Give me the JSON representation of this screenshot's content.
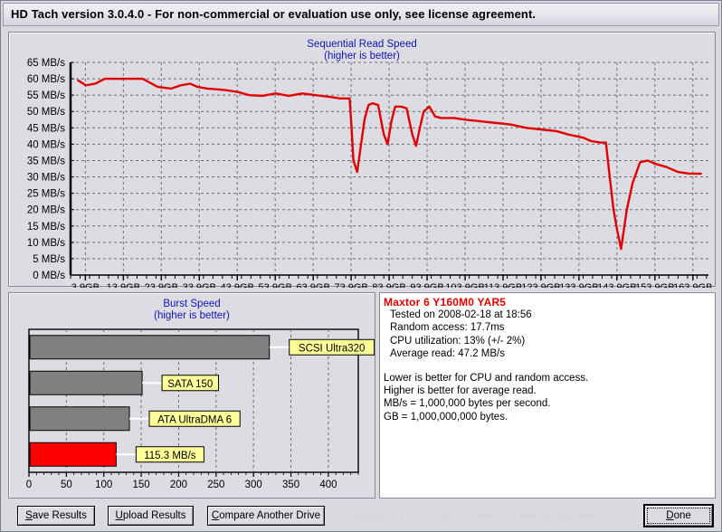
{
  "window": {
    "title": "HD Tach version 3.0.4.0  - For non-commercial or evaluation use only, see license agreement."
  },
  "sequential": {
    "title_line1": "Sequential Read Speed",
    "title_line2": "(higher is better)"
  },
  "burst": {
    "title_line1": "Burst Speed",
    "title_line2": "(higher is better)"
  },
  "info": {
    "drive": "Maxtor 6 Y160M0 YAR5",
    "tested": "Tested on 2008-02-18 at 18:56",
    "random_access": "Random access: 17.7ms",
    "cpu": "CPU utilization: 13% (+/- 2%)",
    "avg_read": "Average read: 47.2 MB/s",
    "note1": "Lower is better for CPU and random access.",
    "note2": "Higher is better for average read.",
    "note3": "MB/s = 1,000,000 bytes per second.",
    "note4": "GB = 1,000,000,000 bytes."
  },
  "buttons": {
    "save": "Save Results",
    "save_accel": "S",
    "upload": "Upload Results",
    "upload_accel": "U",
    "compare": "Compare Another Drive",
    "compare_accel": "C",
    "done": "Done",
    "done_accel": "D"
  },
  "copyright": "Copyright (C) 2004 Simpli Software, Inc. www.simplisoftware.com",
  "colors": {
    "curve": "#e00000",
    "bar_gray": "#808080",
    "bar_red": "#ff0000",
    "label_yellow": "#ffff99",
    "title_blue": "#1414b4",
    "panel_bg": "#dcdce2",
    "plot_bg": "#dcdce2"
  },
  "chart_data": [
    {
      "type": "line",
      "id": "sequential-read-speed",
      "title": "Sequential Read Speed",
      "subtitle": "(higher is better)",
      "xlabel": "",
      "ylabel": "",
      "grid": true,
      "legend": null,
      "xlim": [
        0,
        168
      ],
      "ylim": [
        0,
        65
      ],
      "ytick_labels": [
        "0 MB/s",
        "5 MB/s",
        "10 MB/s",
        "15 MB/s",
        "20 MB/s",
        "25 MB/s",
        "30 MB/s",
        "35 MB/s",
        "40 MB/s",
        "45 MB/s",
        "50 MB/s",
        "55 MB/s",
        "60 MB/s",
        "65 MB/s"
      ],
      "ytick_values": [
        0,
        5,
        10,
        15,
        20,
        25,
        30,
        35,
        40,
        45,
        50,
        55,
        60,
        65
      ],
      "xtick_labels": [
        "3,9GB",
        "13,9GB",
        "23,9GB",
        "33,9GB",
        "43,9GB",
        "53,9GB",
        "63,9GB",
        "73,9GB",
        "83,9GB",
        "93,9GB",
        "103,9GB",
        "113,9GB",
        "123,9GB",
        "133,9GB",
        "143,9GB",
        "153,9GB",
        "163,9GB"
      ],
      "xtick_values": [
        3.9,
        13.9,
        23.9,
        33.9,
        43.9,
        53.9,
        63.9,
        73.9,
        83.9,
        93.9,
        103.9,
        113.9,
        123.9,
        133.9,
        143.9,
        153.9,
        163.9
      ],
      "series": [
        {
          "name": "Read speed",
          "color": "#e00000",
          "x": [
            2.0,
            4.0,
            6.5,
            9.0,
            12.0,
            15.0,
            19.0,
            23.0,
            26.5,
            29.0,
            31.5,
            33.5,
            36.0,
            38.5,
            41.0,
            44.0,
            47.0,
            50.5,
            54.0,
            57.5,
            61.0,
            64.5,
            68.0,
            71.0,
            73.5,
            74.0,
            74.5,
            75.5,
            76.5,
            77.5,
            78.5,
            79.5,
            81.0,
            82.5,
            83.5,
            84.5,
            85.5,
            87.0,
            88.5,
            90.0,
            91.0,
            92.0,
            93.0,
            94.5,
            96.0,
            97.5,
            99.0,
            101.0,
            104.0,
            108.0,
            112.0,
            116.0,
            120.0,
            124.0,
            128.0,
            131.0,
            133.0,
            135.0,
            137.0,
            139.5,
            141.0,
            142.0,
            143.0,
            144.0,
            145.0,
            146.5,
            148.0,
            150.0,
            152.0,
            154.0,
            157.0,
            160.0,
            163.0,
            166.0
          ],
          "y": [
            59.5,
            58.0,
            58.5,
            60.0,
            60.0,
            60.0,
            60.0,
            57.5,
            57.0,
            58.0,
            58.5,
            57.5,
            57.0,
            56.8,
            56.5,
            56.0,
            55.0,
            54.8,
            55.5,
            54.8,
            55.5,
            55.0,
            54.5,
            54.0,
            54.0,
            45.0,
            35.0,
            31.5,
            40.0,
            48.0,
            52.0,
            52.5,
            52.0,
            43.0,
            40.0,
            47.0,
            51.5,
            51.5,
            51.0,
            43.0,
            39.5,
            45.0,
            50.0,
            51.5,
            48.5,
            48.0,
            48.0,
            48.0,
            47.5,
            47.0,
            46.5,
            46.0,
            45.0,
            44.5,
            44.0,
            43.0,
            42.5,
            42.0,
            41.0,
            40.5,
            40.5,
            30.0,
            20.0,
            13.5,
            8.0,
            20.0,
            28.0,
            34.5,
            35.0,
            34.0,
            33.0,
            31.5,
            31.0,
            31.0
          ]
        }
      ]
    },
    {
      "type": "bar",
      "id": "burst-speed",
      "orientation": "horizontal",
      "title": "Burst Speed",
      "subtitle": "(higher is better)",
      "xlabel": "",
      "ylabel": "",
      "grid": true,
      "xlim": [
        0,
        440
      ],
      "xtick_labels": [
        "0",
        "50",
        "100",
        "150",
        "200",
        "250",
        "300",
        "350",
        "400"
      ],
      "xtick_values": [
        0,
        50,
        100,
        150,
        200,
        250,
        300,
        350,
        400
      ],
      "categories": [
        "SCSI Ultra320",
        "SATA 150",
        "ATA UltraDMA 6",
        "115.3 MB/s"
      ],
      "values": [
        320,
        150,
        133,
        115.3
      ],
      "bar_colors": [
        "#808080",
        "#808080",
        "#808080",
        "#ff0000"
      ],
      "data_labels": [
        "SCSI Ultra320",
        "SATA 150",
        "ATA UltraDMA 6",
        "115.3 MB/s"
      ]
    }
  ]
}
